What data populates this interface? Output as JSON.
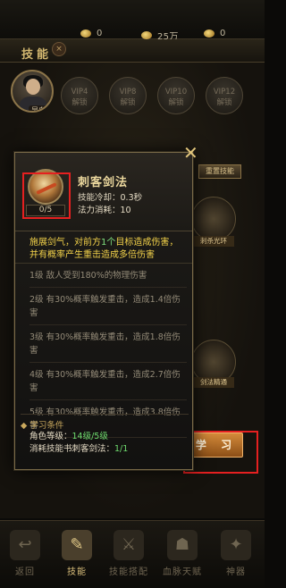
{
  "topbar": {
    "currency1": "0",
    "currency2": "25万",
    "currency3": "0"
  },
  "header": {
    "title": "技能",
    "close": "×"
  },
  "player": {
    "name": "吴白升"
  },
  "vip_slots": [
    {
      "line1": "VIP1",
      "line2": "解锁"
    },
    {
      "line1": "VIP4",
      "line2": "解锁"
    },
    {
      "line1": "VIP8",
      "line2": "解锁"
    },
    {
      "line1": "VIP10",
      "line2": "解锁"
    },
    {
      "line1": "VIP12",
      "line2": "解锁"
    }
  ],
  "side": {
    "reset_button": "重置技能",
    "skill_tags": [
      "刺杀光环",
      "剑法精通"
    ]
  },
  "popup": {
    "name": "刺客剑法",
    "level": "0/5",
    "cooldown": "技能冷却：0.3秒",
    "mana": "法力消耗：10",
    "desc_line1_a": "施展剑气，对前方",
    "desc_line1_hl": "1个",
    "desc_line1_b": "目标造成伤害，",
    "desc_line2": "并有概率产生重击造成多倍伤害",
    "levels": [
      "1级 敌人受到180%的物理伤害",
      "2级 有30%概率触发重击，造成1.4倍伤害",
      "3级 有30%概率触发重击，造成1.8倍伤害",
      "4级 有30%概率触发重击，造成2.7倍伤害",
      "5级 有30%概率触发重击，造成3.8倍伤害"
    ],
    "cond_title": "◆ 学习条件",
    "cond1_label": "角色等级：",
    "cond1_value": "14级/5级",
    "cond2_label": "消耗技能书刺客剑法：",
    "cond2_value": "1/1",
    "close": "✕"
  },
  "learn_button": "学 习",
  "tabs": [
    {
      "label": "返回",
      "glyph": "↩"
    },
    {
      "label": "技能",
      "glyph": "✎"
    },
    {
      "label": "技能搭配",
      "glyph": "⚔"
    },
    {
      "label": "血脉天赋",
      "glyph": "☗"
    },
    {
      "label": "神器",
      "glyph": "✦"
    }
  ],
  "colors": {
    "highlight_red": "#e52020",
    "gold": "#ecd89e",
    "green": "#6fdd6f",
    "yellow": "#f3d24a"
  }
}
